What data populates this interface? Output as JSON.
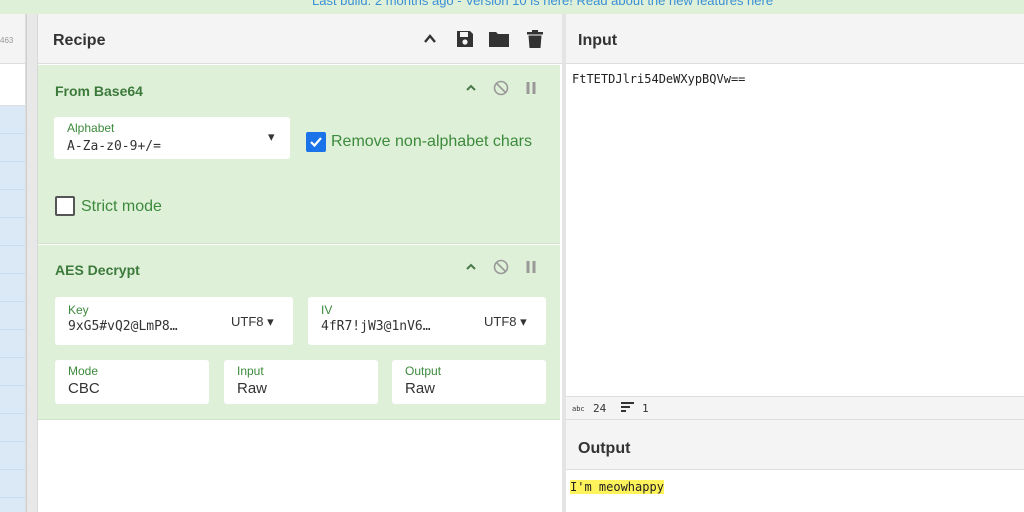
{
  "banner": {
    "text": "Last build: 2 months ago - Version 10 is here! Read about the new features here"
  },
  "operations": {
    "count": "463"
  },
  "recipe": {
    "title": "Recipe",
    "icons": [
      "chevron-up-icon",
      "save-icon",
      "folder-icon",
      "trash-icon"
    ],
    "ops": [
      {
        "name": "From Base64",
        "alphabet_label": "Alphabet",
        "alphabet_value": "A-Za-z0-9+/=",
        "remove_nonalpha_label": "Remove non-alphabet chars",
        "remove_nonalpha_checked": true,
        "strict_label": "Strict mode",
        "strict_checked": false
      },
      {
        "name": "AES Decrypt",
        "key_label": "Key",
        "key_value": "9xG5#vQ2@LmP8…",
        "key_encoding": "UTF8",
        "iv_label": "IV",
        "iv_value": "4fR7!jW3@1nV6…",
        "iv_encoding": "UTF8",
        "mode_label": "Mode",
        "mode_value": "CBC",
        "input_label": "Input",
        "input_value": "Raw",
        "output_label": "Output",
        "output_value": "Raw"
      }
    ]
  },
  "input": {
    "title": "Input",
    "text": "FtTETDJlri54DeWXypBQVw==",
    "status_chars_icon": "abc",
    "status_chars": "24",
    "status_lines": "1"
  },
  "output": {
    "title": "Output",
    "text": "I'm meowhappy"
  },
  "colors": {
    "accent": "#1a73e8",
    "op_bg": "#dff0d8",
    "op_label": "#3c8a3c",
    "highlight": "#fff35c"
  }
}
